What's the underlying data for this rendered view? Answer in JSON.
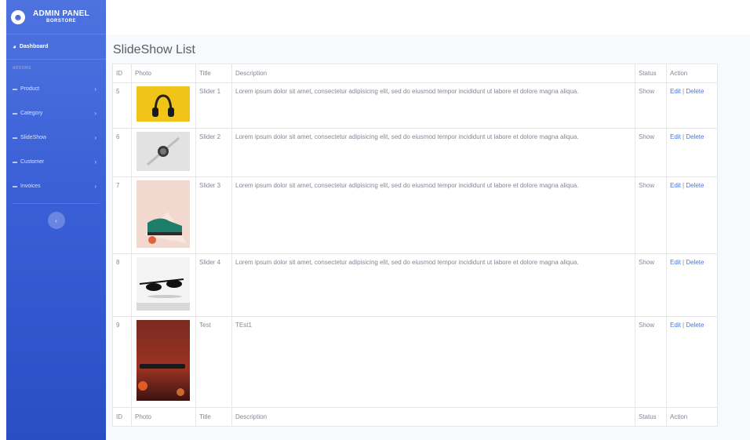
{
  "sidebar": {
    "brand_title": "ADMIN PANEL",
    "brand_sub": "BORSTORE",
    "dashboard": "Dashboard",
    "heading": "ADDONS",
    "items": [
      {
        "label": "Product"
      },
      {
        "label": "Category"
      },
      {
        "label": "SlideShow"
      },
      {
        "label": "Customer"
      },
      {
        "label": "Invoices"
      }
    ]
  },
  "main": {
    "title": "SlideShow List",
    "columns": [
      "ID",
      "Photo",
      "Title",
      "Description",
      "Status",
      "Action"
    ],
    "rows": [
      {
        "id": "5",
        "title": "Slider 1",
        "description": "Lorem ipsum dolor sit amet, consectetur adipisicing elit, sed do eiusmod tempor incididunt ut labore et dolore magna aliqua.",
        "status": "Show",
        "edit": "Edit",
        "sep": " | ",
        "delete": "Delete"
      },
      {
        "id": "6",
        "title": "Slider 2",
        "description": "Lorem ipsum dolor sit amet, consectetur adipisicing elit, sed do eiusmod tempor incididunt ut labore et dolore magna aliqua.",
        "status": "Show",
        "edit": "Edit",
        "sep": " | ",
        "delete": "Delete"
      },
      {
        "id": "7",
        "title": "Slider 3",
        "description": "Lorem ipsum dolor sit amet, consectetur adipisicing elit, sed do eiusmod tempor incididunt ut labore et dolore magna aliqua.",
        "status": "Show",
        "edit": "Edit",
        "sep": " | ",
        "delete": "Delete"
      },
      {
        "id": "8",
        "title": "Slider 4",
        "description": "Lorem ipsum dolor sit amet, consectetur adipisicing elit, sed do eiusmod tempor incididunt ut labore et dolore magna aliqua.",
        "status": "Show",
        "edit": "Edit",
        "sep": " | ",
        "delete": "Delete"
      },
      {
        "id": "9",
        "title": "Test",
        "description": "TEst1",
        "status": "Show",
        "edit": "Edit",
        "sep": " | ",
        "delete": "Delete"
      }
    ]
  },
  "colors": {
    "accent": "#4e73df",
    "sidebar_bottom": "#2a4dc4"
  },
  "icons": {
    "brand": "laugh-face-icon",
    "dashboard": "tachometer-icon",
    "folder": "folder-icon",
    "chevron": "chevron-right-icon",
    "toggle": "chevron-left-icon"
  }
}
